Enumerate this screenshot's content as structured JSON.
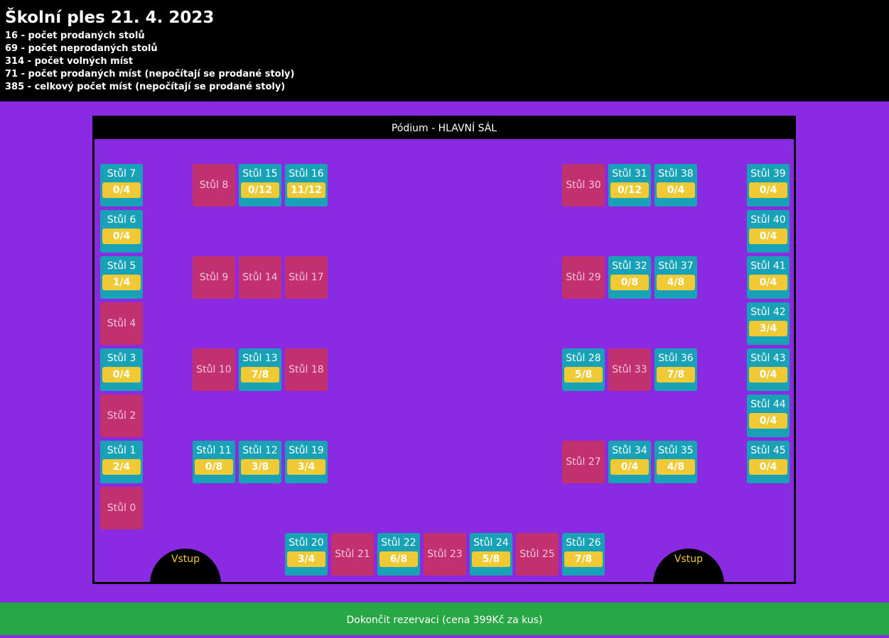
{
  "header": {
    "title": "Školní ples 21. 4. 2023",
    "stats": [
      "16 - počet prodaných stolů",
      "69 - počet neprodaných stolů",
      "314 - počet volných míst",
      "71 - počet prodaných míst (nepočítají se prodané stoly)",
      "385 - celkový počet míst (nepočítají se prodané stoly)"
    ]
  },
  "hall": {
    "stage_label": "Pódium - HLAVNÍ SÁL",
    "entrances": [
      "Vstup",
      "Vstup"
    ]
  },
  "tables": [
    {
      "id": 0,
      "label": "Stůl 0",
      "status": "sold"
    },
    {
      "id": 1,
      "label": "Stůl 1",
      "status": "available",
      "count": "2/4"
    },
    {
      "id": 2,
      "label": "Stůl 2",
      "status": "sold"
    },
    {
      "id": 3,
      "label": "Stůl 3",
      "status": "available",
      "count": "0/4"
    },
    {
      "id": 4,
      "label": "Stůl 4",
      "status": "sold"
    },
    {
      "id": 5,
      "label": "Stůl 5",
      "status": "available",
      "count": "1/4"
    },
    {
      "id": 6,
      "label": "Stůl 6",
      "status": "available",
      "count": "0/4"
    },
    {
      "id": 7,
      "label": "Stůl 7",
      "status": "available",
      "count": "0/4"
    },
    {
      "id": 8,
      "label": "Stůl 8",
      "status": "sold"
    },
    {
      "id": 9,
      "label": "Stůl 9",
      "status": "sold"
    },
    {
      "id": 10,
      "label": "Stůl 10",
      "status": "sold"
    },
    {
      "id": 11,
      "label": "Stůl 11",
      "status": "available",
      "count": "0/8"
    },
    {
      "id": 12,
      "label": "Stůl 12",
      "status": "available",
      "count": "3/8"
    },
    {
      "id": 13,
      "label": "Stůl 13",
      "status": "available",
      "count": "7/8"
    },
    {
      "id": 14,
      "label": "Stůl 14",
      "status": "sold"
    },
    {
      "id": 15,
      "label": "Stůl 15",
      "status": "available",
      "count": "0/12"
    },
    {
      "id": 16,
      "label": "Stůl 16",
      "status": "available",
      "count": "11/12"
    },
    {
      "id": 17,
      "label": "Stůl 17",
      "status": "sold"
    },
    {
      "id": 18,
      "label": "Stůl 18",
      "status": "sold"
    },
    {
      "id": 19,
      "label": "Stůl 19",
      "status": "available",
      "count": "3/4"
    },
    {
      "id": 20,
      "label": "Stůl 20",
      "status": "available",
      "count": "3/4"
    },
    {
      "id": 21,
      "label": "Stůl 21",
      "status": "sold"
    },
    {
      "id": 22,
      "label": "Stůl 22",
      "status": "available",
      "count": "6/8"
    },
    {
      "id": 23,
      "label": "Stůl 23",
      "status": "sold"
    },
    {
      "id": 24,
      "label": "Stůl 24",
      "status": "available",
      "count": "5/8"
    },
    {
      "id": 25,
      "label": "Stůl 25",
      "status": "sold"
    },
    {
      "id": 26,
      "label": "Stůl 26",
      "status": "available",
      "count": "7/8"
    },
    {
      "id": 27,
      "label": "Stůl 27",
      "status": "sold"
    },
    {
      "id": 28,
      "label": "Stůl 28",
      "status": "available",
      "count": "5/8"
    },
    {
      "id": 29,
      "label": "Stůl 29",
      "status": "sold"
    },
    {
      "id": 30,
      "label": "Stůl 30",
      "status": "sold"
    },
    {
      "id": 31,
      "label": "Stůl 31",
      "status": "available",
      "count": "0/12"
    },
    {
      "id": 32,
      "label": "Stůl 32",
      "status": "available",
      "count": "0/8"
    },
    {
      "id": 33,
      "label": "Stůl 33",
      "status": "sold"
    },
    {
      "id": 34,
      "label": "Stůl 34",
      "status": "available",
      "count": "0/4"
    },
    {
      "id": 35,
      "label": "Stůl 35",
      "status": "available",
      "count": "4/8"
    },
    {
      "id": 36,
      "label": "Stůl 36",
      "status": "available",
      "count": "7/8"
    },
    {
      "id": 37,
      "label": "Stůl 37",
      "status": "available",
      "count": "4/8"
    },
    {
      "id": 38,
      "label": "Stůl 38",
      "status": "available",
      "count": "0/4"
    },
    {
      "id": 39,
      "label": "Stůl 39",
      "status": "available",
      "count": "0/4"
    },
    {
      "id": 40,
      "label": "Stůl 40",
      "status": "available",
      "count": "0/4"
    },
    {
      "id": 41,
      "label": "Stůl 41",
      "status": "available",
      "count": "0/4"
    },
    {
      "id": 42,
      "label": "Stůl 42",
      "status": "available",
      "count": "3/4"
    },
    {
      "id": 43,
      "label": "Stůl 43",
      "status": "available",
      "count": "0/4"
    },
    {
      "id": 44,
      "label": "Stůl 44",
      "status": "available",
      "count": "0/4"
    },
    {
      "id": 45,
      "label": "Stůl 45",
      "status": "available",
      "count": "0/4"
    }
  ],
  "footer": {
    "finish_label": "Dokončit rezervaci (cena 399Kč za kus)"
  },
  "colors": {
    "background": "#8a2be2",
    "available": "#17a2b8",
    "sold": "#c2306f",
    "count_badge": "#f0ca35",
    "finish_button": "#28a745"
  }
}
